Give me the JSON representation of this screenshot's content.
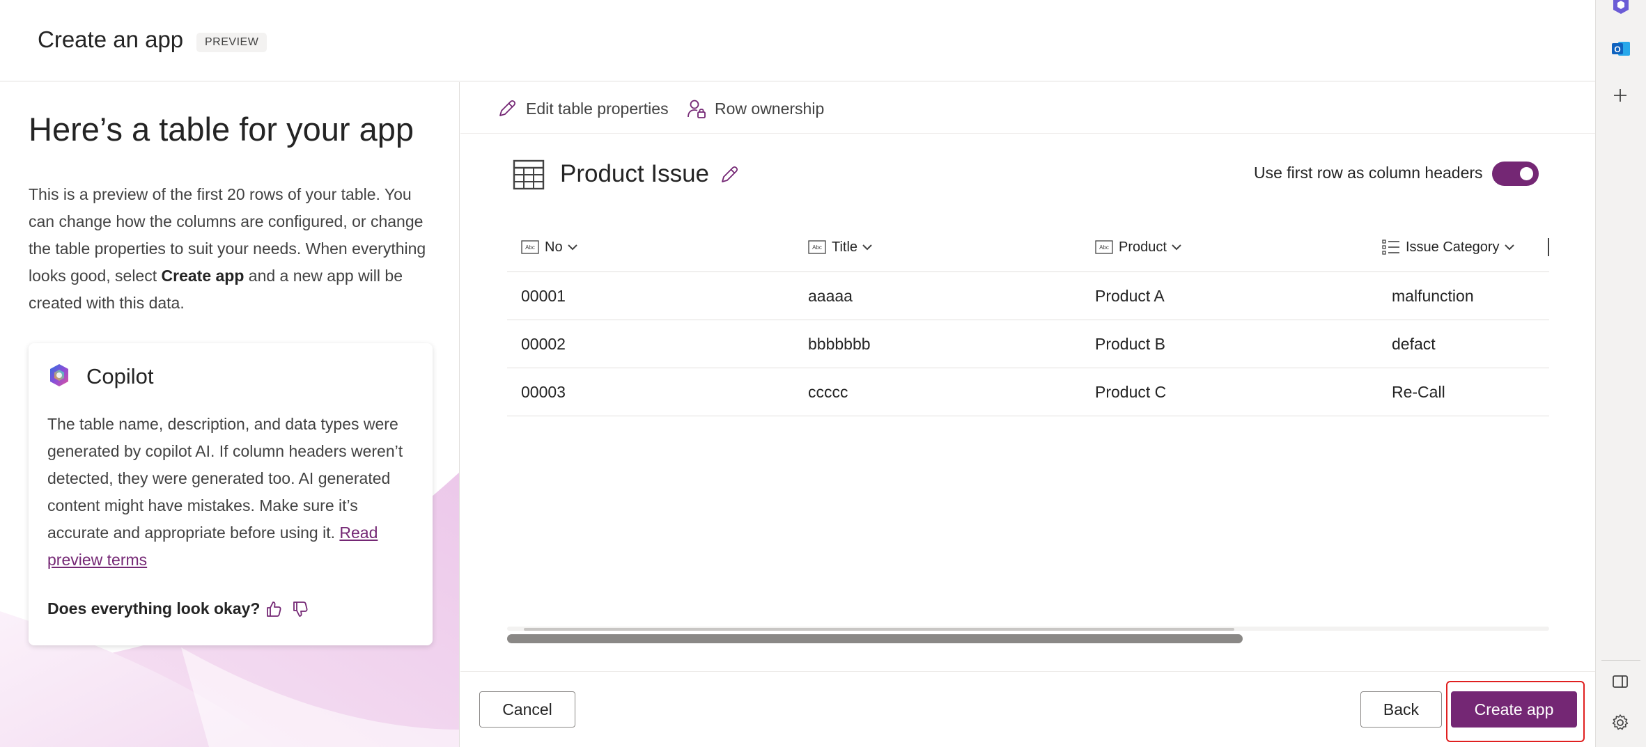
{
  "header": {
    "title": "Create an app",
    "badge": "PREVIEW"
  },
  "left": {
    "heading": "Here’s a table for your app",
    "desc_part1": "This is a preview of the first 20 rows of your table. You can change how the columns are configured, or change the table properties to suit your needs. When everything looks good, select ",
    "desc_bold": "Create app",
    "desc_part2": " and a new app will be created with this data.",
    "copilot": {
      "title": "Copilot",
      "text": "The table name, description, and data types were generated by copilot AI. If column headers weren’t detected, they were generated too. AI generated content might have mistakes. Make sure it’s accurate and appropriate before using it. ",
      "link": "Read preview terms",
      "feedback_question": "Does everything look okay?"
    }
  },
  "toolbar": {
    "edit_label": "Edit table properties",
    "ownership_label": "Row ownership"
  },
  "table": {
    "name": "Product Issue",
    "toggle_label": "Use first row as column headers",
    "toggle_on": true,
    "columns": [
      {
        "label": "No",
        "type_icon": "text-type-icon"
      },
      {
        "label": "Title",
        "type_icon": "text-type-icon"
      },
      {
        "label": "Product",
        "type_icon": "text-type-icon"
      },
      {
        "label": "Issue Category",
        "type_icon": "choice-list-icon"
      }
    ],
    "rows": [
      [
        "00001",
        "aaaaa",
        "Product A",
        "malfunction"
      ],
      [
        "00002",
        "bbbbbbb",
        "Product B",
        "defact"
      ],
      [
        "00003",
        "ccccc",
        "Product C",
        "Re-Call"
      ]
    ]
  },
  "footer": {
    "cancel": "Cancel",
    "back": "Back",
    "create": "Create app"
  },
  "colors": {
    "accent": "#742774",
    "highlight": "#e02020"
  }
}
